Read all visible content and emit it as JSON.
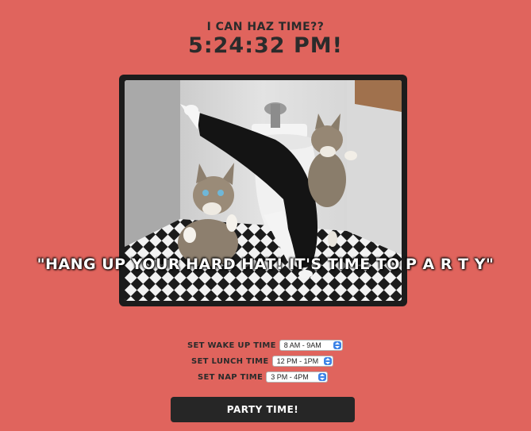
{
  "header": {
    "subtitle": "I CAN HAZ TIME??",
    "clock": "5:24:32 PM!"
  },
  "photo": {
    "alt": "kittens dancing in bathroom",
    "caption": "\"HANG UP YOUR HARD HAT! IT'S TIME TO P A R T Y\""
  },
  "settings": {
    "wake": {
      "label": "SET WAKE UP TIME",
      "value": "8 AM - 9AM"
    },
    "lunch": {
      "label": "SET LUNCH TIME",
      "value": "12 PM - 1PM"
    },
    "nap": {
      "label": "SET NAP TIME",
      "value": "3 PM - 4PM"
    }
  },
  "party_button": {
    "label": "PARTY TIME!"
  },
  "colors": {
    "background": "#e0645d",
    "text": "#2b2b2b",
    "button": "#262626",
    "stepper": "#3b82e6"
  }
}
